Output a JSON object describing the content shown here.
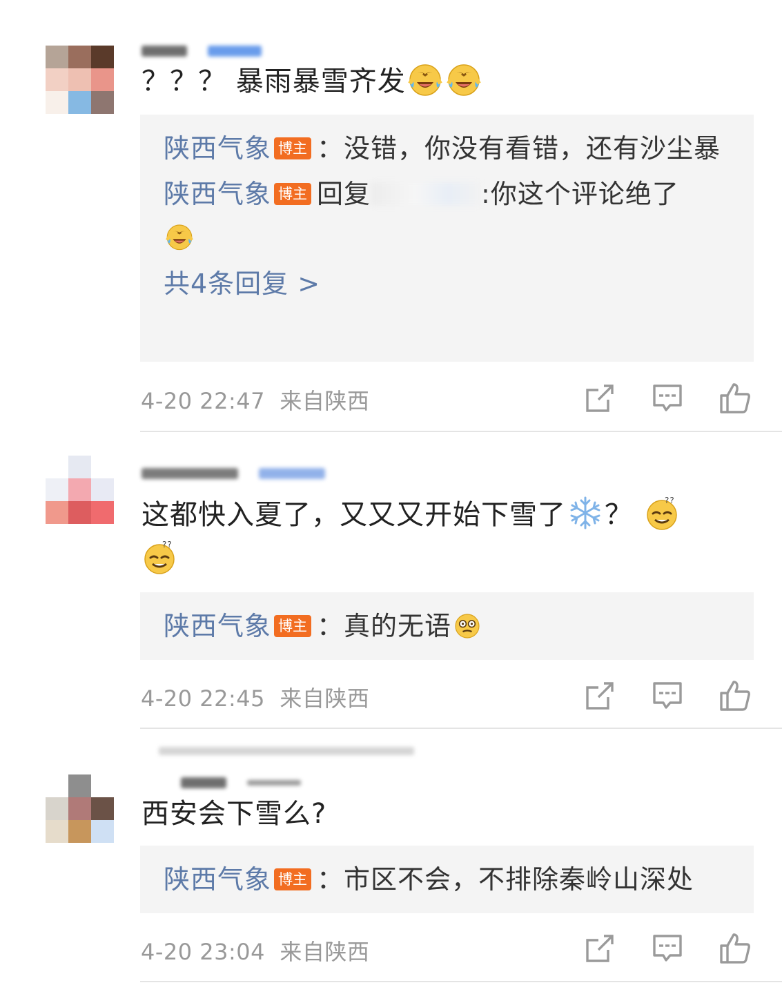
{
  "comments": [
    {
      "text": "？？？ 暴雨暴雪齐发",
      "emojis": [
        "laugh-cry-icon",
        "laugh-cry-icon"
      ],
      "avatar_colors": [
        "#b5a497",
        "#9a6e5d",
        "#5a3a2a",
        "#f2d0c4",
        "#eec0b2",
        "#e9958a",
        "#f8f0ea",
        "#86b9e3",
        "#8e7670"
      ],
      "replies": [
        {
          "author": "陕西气象",
          "badge": "博主",
          "text": "：没错，你没有看错，还有沙尘暴"
        },
        {
          "author": "陕西气象",
          "badge": "博主",
          "prefix": "回复",
          "text": ":你这个评论绝了"
        }
      ],
      "more_replies": "共4条回复 >",
      "time": "4-20 22:47",
      "source": "来自陕西"
    },
    {
      "text": "这都快入夏了，又又又开始下雪了",
      "question": "？",
      "emojis": [
        "snowflake-icon",
        "dizzy-smile-icon",
        "dizzy-smile-icon"
      ],
      "avatar_colors": [
        "#ffffff",
        "#e6e9f2",
        "#ffffff",
        "#eef0f6",
        "#f3a9b0",
        "#e8eaf4",
        "#f0998c",
        "#dd5d5f",
        "#f06b6e"
      ],
      "replies": [
        {
          "author": "陕西气象",
          "badge": "博主",
          "text": "：真的无语"
        }
      ],
      "time": "4-20 22:45",
      "source": "来自陕西"
    },
    {
      "text": "西安会下雪么?",
      "avatar_colors": [
        "#ffffff",
        "#8e8e8e",
        "#ffffff",
        "#d8d4cc",
        "#b07a78",
        "#6b5247",
        "#e6dccb",
        "#c7965c",
        "#cfe0f4"
      ],
      "replies": [
        {
          "author": "陕西气象",
          "badge": "博主",
          "text": "：市区不会，不排除秦岭山深处"
        }
      ],
      "time": "4-20 23:04",
      "source": "来自陕西"
    }
  ],
  "actions": [
    "share-icon",
    "comment-icon",
    "like-icon"
  ],
  "colors": {
    "author": "#5d7aa8",
    "badge": "#f26d21",
    "reply_bg": "#f4f4f4",
    "meta": "#999999"
  }
}
